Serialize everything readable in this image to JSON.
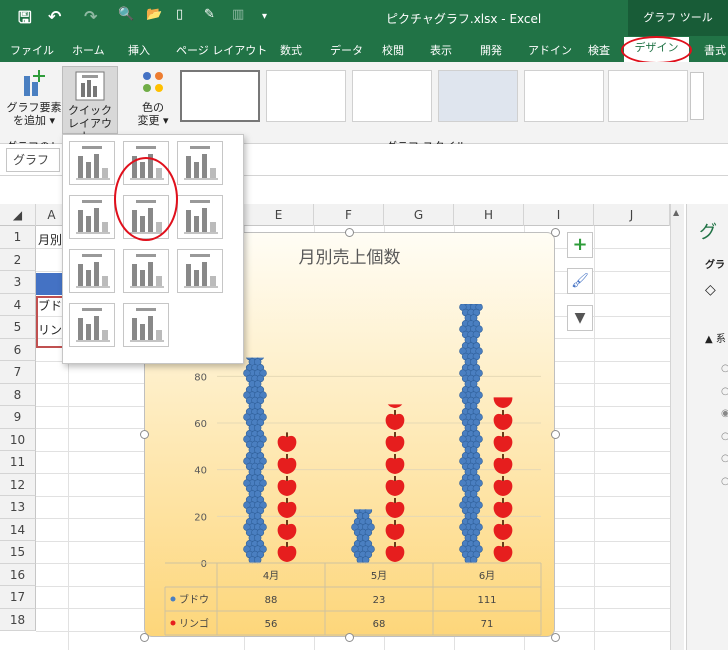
{
  "titlebar": {
    "document_title": "ピクチャグラフ.xlsx  -  Excel",
    "context_tab": "グラフ ツール",
    "qat_icons": [
      "save-icon",
      "undo-icon",
      "redo-icon",
      "print-preview-icon",
      "open-icon",
      "new-icon",
      "format-painter-icon",
      "chart-icon",
      "customize-icon"
    ]
  },
  "ribbon_tabs": [
    "ファイル",
    "ホーム",
    "挿入",
    "ページ レイアウト",
    "数式",
    "データ",
    "校閲",
    "表示",
    "開発",
    "アドイン",
    "検査",
    "デザイン",
    "書式"
  ],
  "ribbon": {
    "add_element": [
      "グラフ要素",
      "を追加 ▾"
    ],
    "quick_layout": [
      "クイック",
      "レイアウト ▾"
    ],
    "change_colors": [
      "色の",
      "変更 ▾"
    ],
    "group_layouts": "グラフのレ",
    "group_styles": "グラフ スタイル"
  },
  "formula": {
    "namebox": "グラフ"
  },
  "columns": [
    "A",
    "E",
    "F",
    "G",
    "H",
    "I",
    "J"
  ],
  "rows": [
    "1",
    "2",
    "3",
    "4",
    "5",
    "6",
    "7",
    "8",
    "9",
    "10",
    "11",
    "12",
    "13",
    "14",
    "15",
    "16",
    "17",
    "18"
  ],
  "cells": {
    "a1": "月別",
    "a4": "ブド",
    "a5": "リン"
  },
  "pane": {
    "title": "グ",
    "sub": "グラ",
    "item": "系"
  },
  "chart_data": {
    "type": "bar",
    "title": "月別売上個数",
    "categories": [
      "4月",
      "5月",
      "6月"
    ],
    "series": [
      {
        "name": "ブドウ",
        "values": [
          88,
          23,
          111
        ],
        "color": "#4a7fc1",
        "icon": "grape-icon"
      },
      {
        "name": "リンゴ",
        "values": [
          56,
          68,
          71
        ],
        "color": "#e61e1e",
        "icon": "apple-icon"
      }
    ],
    "y_ticks": [
      "0",
      "20",
      "40",
      "60",
      "80"
    ],
    "ylim": [
      0,
      120
    ],
    "grid": true,
    "data_table": true
  }
}
